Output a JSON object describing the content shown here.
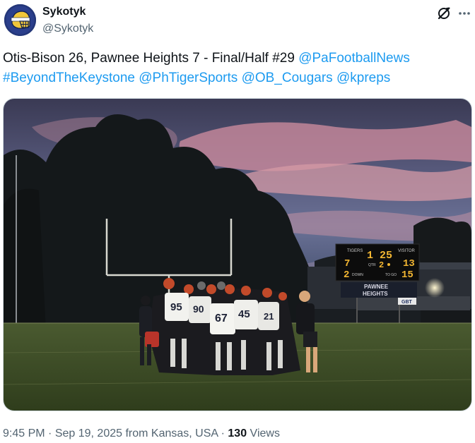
{
  "author": {
    "name": "Sykotyk",
    "handle": "@Sykotyk",
    "avatar_icon": "helmet-logo-icon"
  },
  "actions": {
    "grok_icon": "grok-icon",
    "more_icon": "more-icon"
  },
  "post": {
    "line1_text": "Otis-Bison 26, Pawnee Heights 7 - Final/Half #29 ",
    "mention1": "@PaFootballNews",
    "hashtag1": "#BeyondTheKeystone",
    "mention2": "@PhTigerSports",
    "mention3": "@OB_Cougars",
    "mention4": "@kpreps"
  },
  "photo": {
    "scoreboard": {
      "home_label": "TIGERS",
      "visitor_label": "VISITOR",
      "clock": "1 25",
      "home_score": "7",
      "visitor_score": "13",
      "qtr_label": "QTR",
      "qtr": "2",
      "down_label": "DOWN",
      "down": "2",
      "togo_label": "TO GO",
      "togo": "15",
      "sign_line1": "PAWNEE",
      "sign_line2": "HEIGHTS",
      "sponsor": "GBT"
    },
    "jerseys": [
      "95",
      "90",
      "67",
      "45",
      "21"
    ]
  },
  "meta": {
    "time": "9:45 PM",
    "sep1": " · ",
    "date": "Sep 19, 2025",
    "from": " from Kansas, USA",
    "sep2": " · ",
    "views_count": "130",
    "views_label": " Views"
  },
  "colors": {
    "link": "#1d9bf0",
    "secondary_text": "#536471",
    "primary_text": "#0f1419",
    "scoreboard_digits": "#f2b632"
  }
}
